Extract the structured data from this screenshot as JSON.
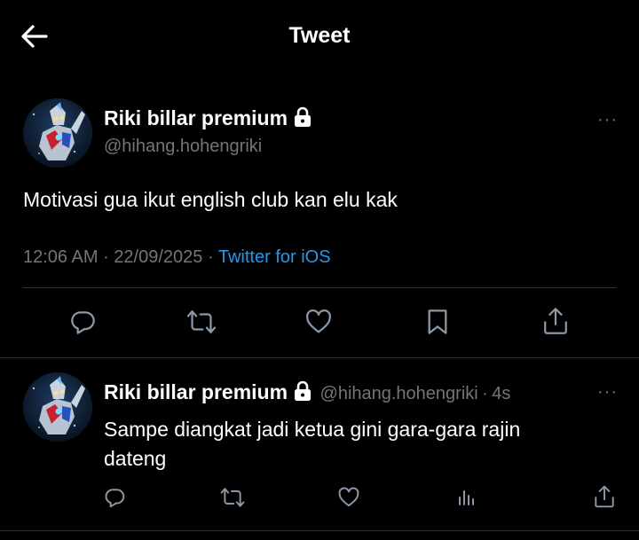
{
  "header": {
    "title": "Tweet",
    "back_icon": "arrow-left-icon"
  },
  "tweet": {
    "display_name": "Riki billar premium",
    "handle": "@hihang.hohengriki",
    "text": "Motivasi gua ikut english club kan elu kak",
    "time": "12:06 AM",
    "date": "22/09/2025",
    "separator": "·",
    "source": "Twitter for iOS",
    "actions": [
      "reply-icon",
      "retweet-icon",
      "like-icon",
      "bookmark-icon",
      "share-icon"
    ]
  },
  "reply": {
    "display_name": "Riki billar premium",
    "handle": "@hihang.hohengriki",
    "separator": "·",
    "age": "4s",
    "text_line1": "Sampe diangkat jadi ketua gini gara-gara rajin",
    "text_line2": "dateng",
    "actions": [
      "reply-icon",
      "retweet-icon",
      "like-icon",
      "views-icon",
      "share-icon"
    ]
  },
  "more_label": "···",
  "colors": {
    "background": "#000000",
    "text": "#e7e9ea",
    "muted": "#71767b",
    "link": "#1d9bf0",
    "divider": "#2f3336"
  }
}
